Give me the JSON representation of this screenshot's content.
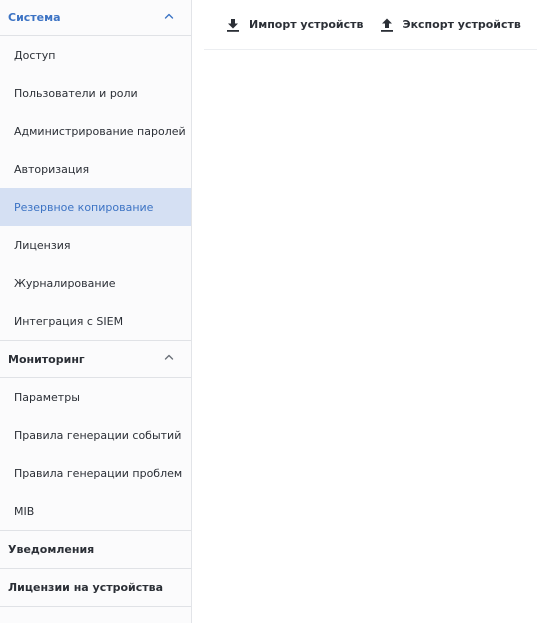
{
  "toolbar": {
    "import_label": "Импорт устройств",
    "export_label": "Экспорт устройств",
    "import_icon": "download-icon",
    "export_icon": "upload-icon"
  },
  "sidebar": {
    "sections": [
      {
        "title": "Система",
        "expanded": true,
        "active": true,
        "items": [
          {
            "label": "Доступ"
          },
          {
            "label": "Пользователи и роли"
          },
          {
            "label": "Администрирование паролей"
          },
          {
            "label": "Авторизация"
          },
          {
            "label": "Резервное копирование",
            "selected": true
          },
          {
            "label": "Лицензия"
          },
          {
            "label": "Журналирование"
          },
          {
            "label": "Интеграция с SIEM"
          }
        ]
      },
      {
        "title": "Мониторинг",
        "expanded": true,
        "items": [
          {
            "label": "Параметры"
          },
          {
            "label": "Правила генерации событий"
          },
          {
            "label": "Правила генерации проблем"
          },
          {
            "label": "MIB"
          }
        ]
      },
      {
        "title": "Уведомления",
        "expanded": false
      },
      {
        "title": "Лицензии на устройства",
        "expanded": false
      }
    ]
  },
  "colors": {
    "accent": "#3c73c4",
    "selected_bg": "#d5e0f3",
    "text": "#2b2f36",
    "sidebar_bg": "#fbfbfc"
  }
}
